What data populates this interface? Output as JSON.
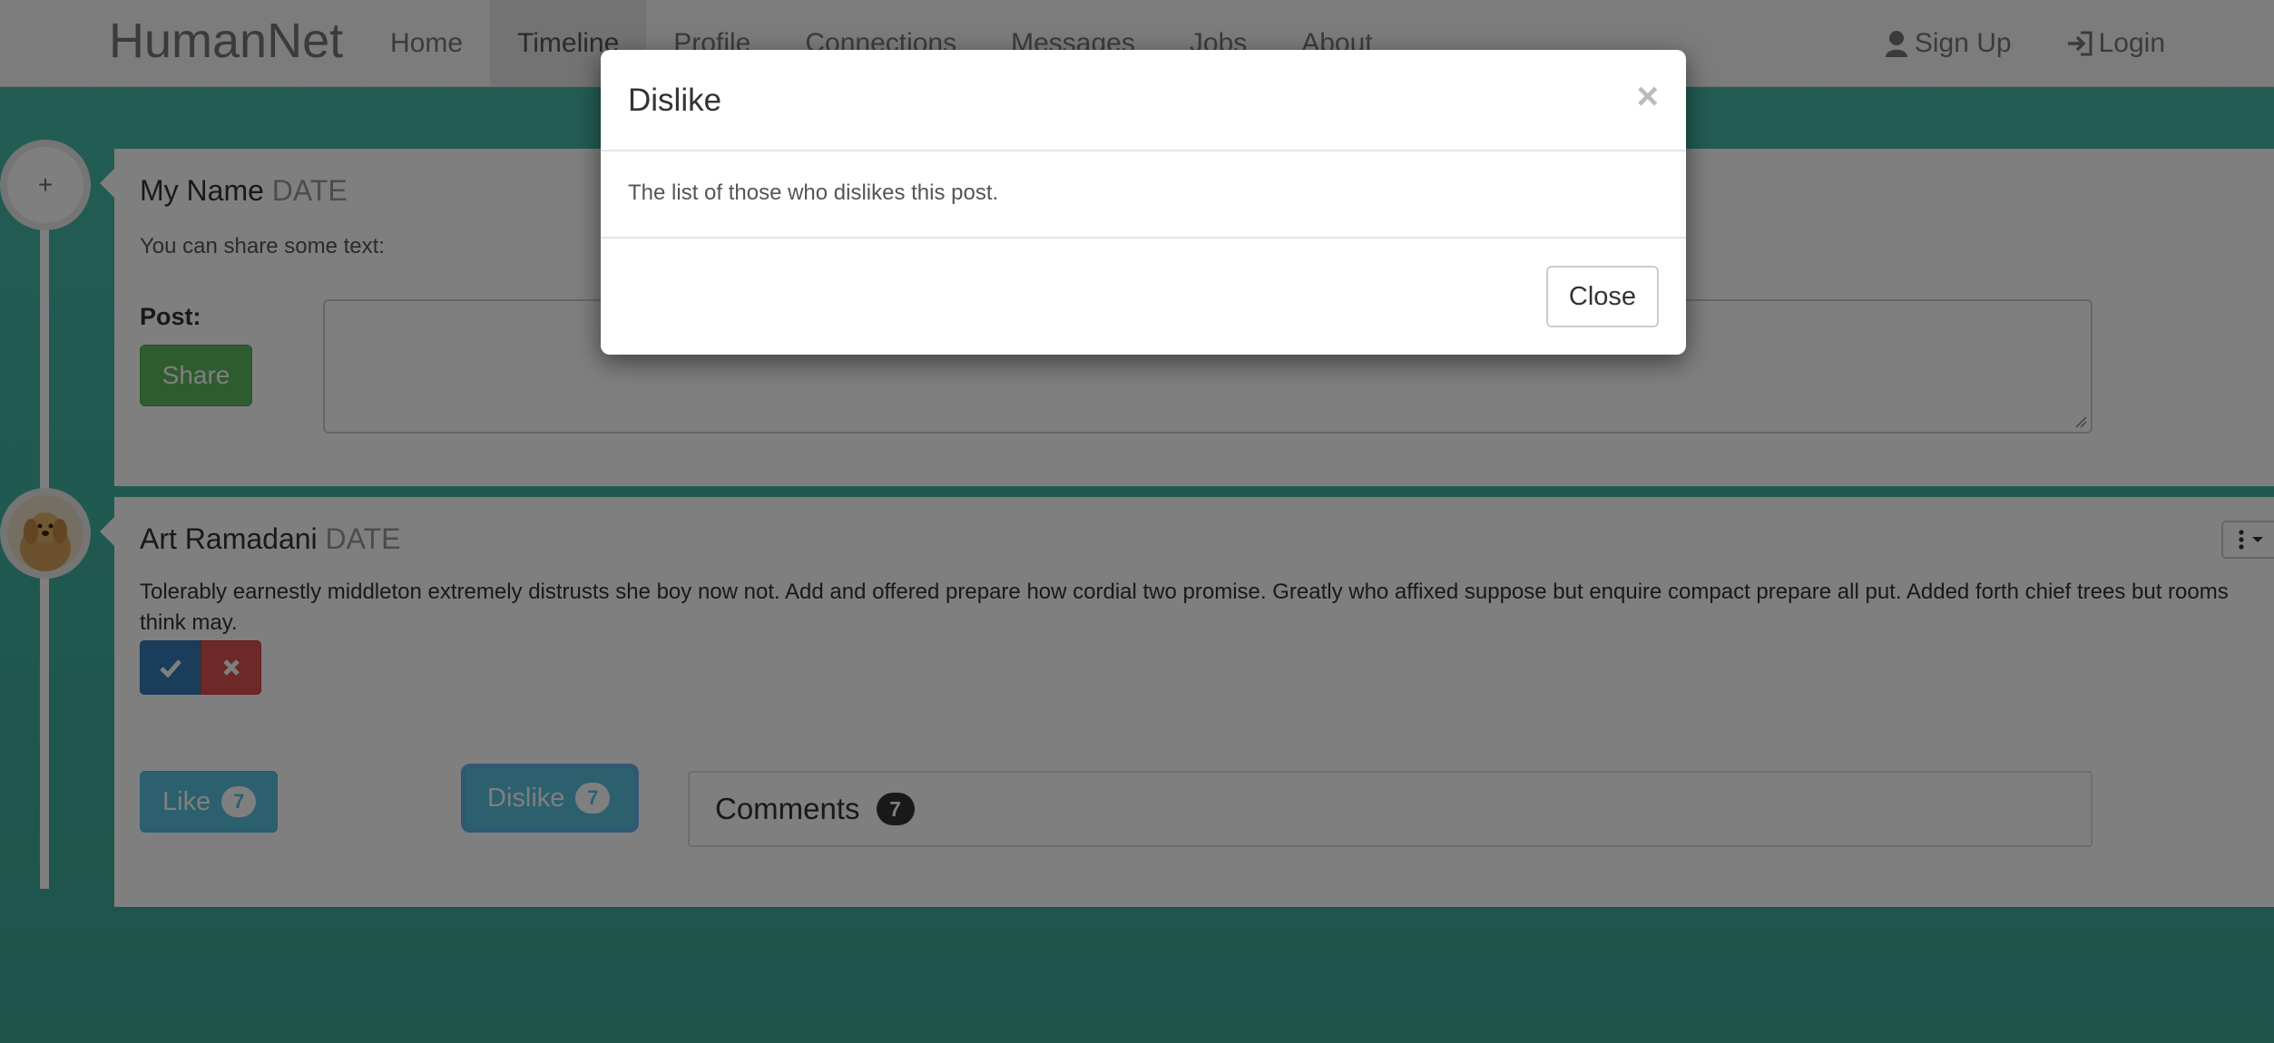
{
  "brand": "HumanNet",
  "nav": {
    "items": [
      {
        "label": "Home"
      },
      {
        "label": "Timeline"
      },
      {
        "label": "Profile"
      },
      {
        "label": "Connections"
      },
      {
        "label": "Messages"
      },
      {
        "label": "Jobs"
      },
      {
        "label": "About"
      }
    ],
    "active": "Timeline",
    "signup_label": "Sign Up",
    "login_label": "Login"
  },
  "timeline": {
    "add_badge_symbol": "+"
  },
  "new_post": {
    "author": "My Name",
    "date": "DATE",
    "prompt": "You can share some text:",
    "post_label": "Post:",
    "share_label": "Share",
    "textarea_value": ""
  },
  "post": {
    "author": "Art Ramadani",
    "date": "DATE",
    "body": "Tolerably earnestly middleton extremely distrusts she boy now not. Add and offered prepare how cordial two promise. Greatly who affixed suppose but enquire compact prepare all put. Added forth chief trees but rooms think may.",
    "like_label": "Like",
    "like_count": "7",
    "dislike_label": "Dislike",
    "dislike_count": "7",
    "comments_label": "Comments",
    "comments_count": "7"
  },
  "modal": {
    "title": "Dislike",
    "close_symbol": "×",
    "body": "The list of those who dislikes this post.",
    "close_label": "Close"
  },
  "colors": {
    "background": "#45bba9",
    "share": "#5cb85c",
    "info": "#5bc0de",
    "primary": "#337ab7",
    "danger": "#d9534f"
  }
}
